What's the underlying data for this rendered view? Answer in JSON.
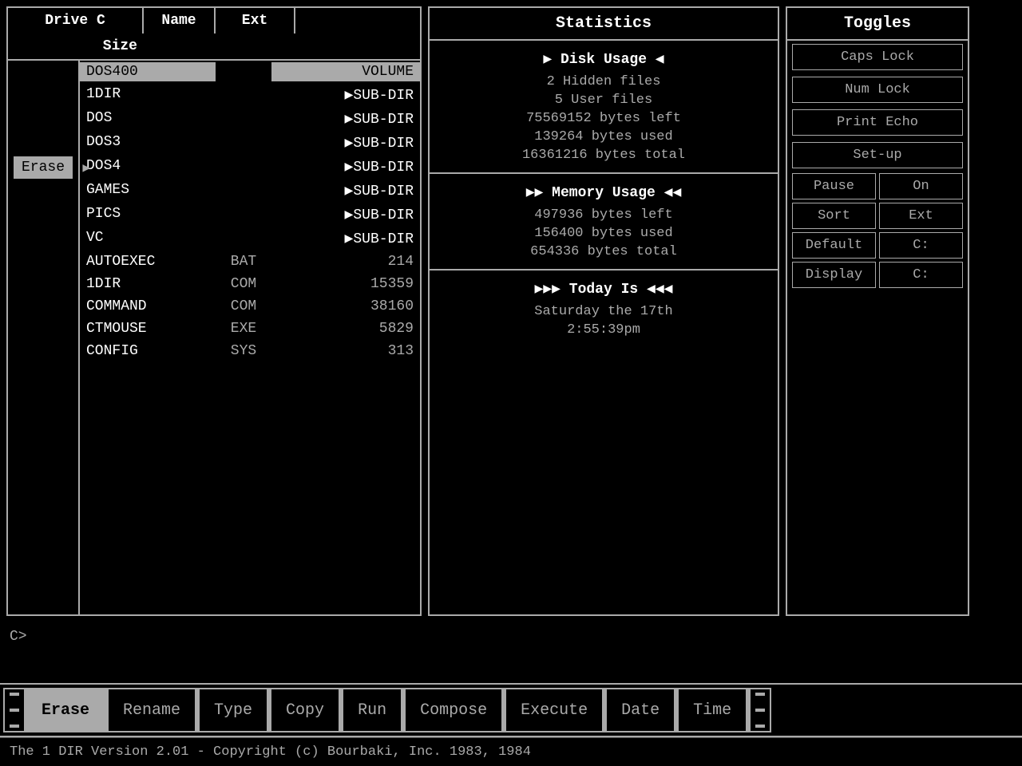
{
  "left_panel": {
    "drive_label": "Drive C",
    "headers": {
      "name": "Name",
      "ext": "Ext",
      "size": "Size"
    },
    "erase_button": "Erase",
    "files": [
      {
        "name": "DOS400",
        "ext": "",
        "size": "VOLUME",
        "selected": true,
        "is_volume": true
      },
      {
        "name": "1DIR",
        "ext": "",
        "size": "▶SUB-DIR",
        "is_subdir": true
      },
      {
        "name": "DOS",
        "ext": "",
        "size": "▶SUB-DIR",
        "is_subdir": true
      },
      {
        "name": "DOS3",
        "ext": "",
        "size": "▶SUB-DIR",
        "is_subdir": true
      },
      {
        "name": "DOS4",
        "ext": "",
        "size": "▶SUB-DIR",
        "is_subdir": true
      },
      {
        "name": "GAMES",
        "ext": "",
        "size": "▶SUB-DIR",
        "is_subdir": true
      },
      {
        "name": "PICS",
        "ext": "",
        "size": "▶SUB-DIR",
        "is_subdir": true
      },
      {
        "name": "VC",
        "ext": "",
        "size": "▶SUB-DIR",
        "is_subdir": true
      },
      {
        "name": "AUTOEXEC",
        "ext": "BAT",
        "size": "214"
      },
      {
        "name": "1DIR",
        "ext": "COM",
        "size": "15359"
      },
      {
        "name": "COMMAND",
        "ext": "COM",
        "size": "38160"
      },
      {
        "name": "CTMOUSE",
        "ext": "EXE",
        "size": "5829"
      },
      {
        "name": "CONFIG",
        "ext": "SYS",
        "size": "313"
      }
    ]
  },
  "stats_panel": {
    "title": "Statistics",
    "disk_usage": {
      "title": "▶  Disk Usage ◀",
      "lines": [
        "2 Hidden files",
        "5 User files",
        "75569152 bytes left",
        "139264 bytes used",
        "16361216 bytes total"
      ]
    },
    "memory_usage": {
      "title": "▶▶  Memory Usage ◀◀",
      "lines": [
        "497936 bytes left",
        "156400 bytes used",
        "654336 bytes total"
      ]
    },
    "today": {
      "title": "▶▶▶  Today Is ◀◀◀",
      "lines": [
        "Saturday the 17th",
        "2:55:39pm"
      ]
    }
  },
  "toggles_panel": {
    "title": "Toggles",
    "caps_lock": "Caps Lock",
    "num_lock": "Num Lock",
    "print_echo": "Print Echo",
    "setup": "Set-up",
    "pause_label": "Pause",
    "pause_value": "On",
    "sort_label": "Sort",
    "sort_value": "Ext",
    "default_label": "Default",
    "default_value": "C:",
    "display_label": "Display",
    "display_value": "C:"
  },
  "cmd_prompt": "C>",
  "toolbar": {
    "erase": "Erase",
    "rename": "Rename",
    "type": "Type",
    "copy": "Copy",
    "run": "Run",
    "compose": "Compose",
    "execute": "Execute",
    "date": "Date",
    "time": "Time"
  },
  "footer": "The 1 DIR Version 2.01 - Copyright (c) Bourbaki, Inc. 1983, 1984"
}
